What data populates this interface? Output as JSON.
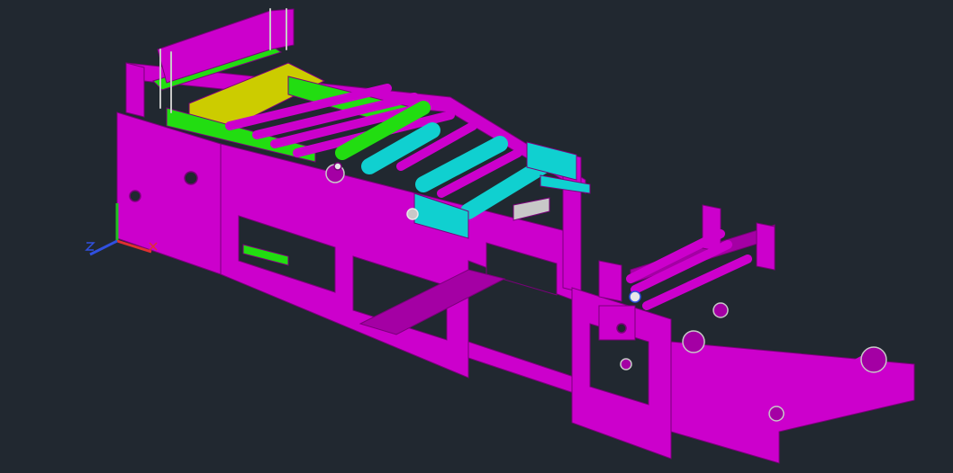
{
  "app": {
    "canvas_background": "#212830"
  },
  "model": {
    "colors": {
      "frame": "#cc00cc",
      "frame_dark": "#a400a4",
      "edge": "#7a007a",
      "green_layer": "#22dd11",
      "yellow_layer": "#cccc00",
      "cyan_layer": "#10d0d0",
      "grey_parts": "#c8c8c8",
      "white_parts": "#e8e8e8"
    }
  },
  "ucs_icon": {
    "axes": [
      "X",
      "Y",
      "Z"
    ],
    "colors": {
      "x": "#e03030",
      "y": "#20c020",
      "z": "#3050e0"
    }
  }
}
